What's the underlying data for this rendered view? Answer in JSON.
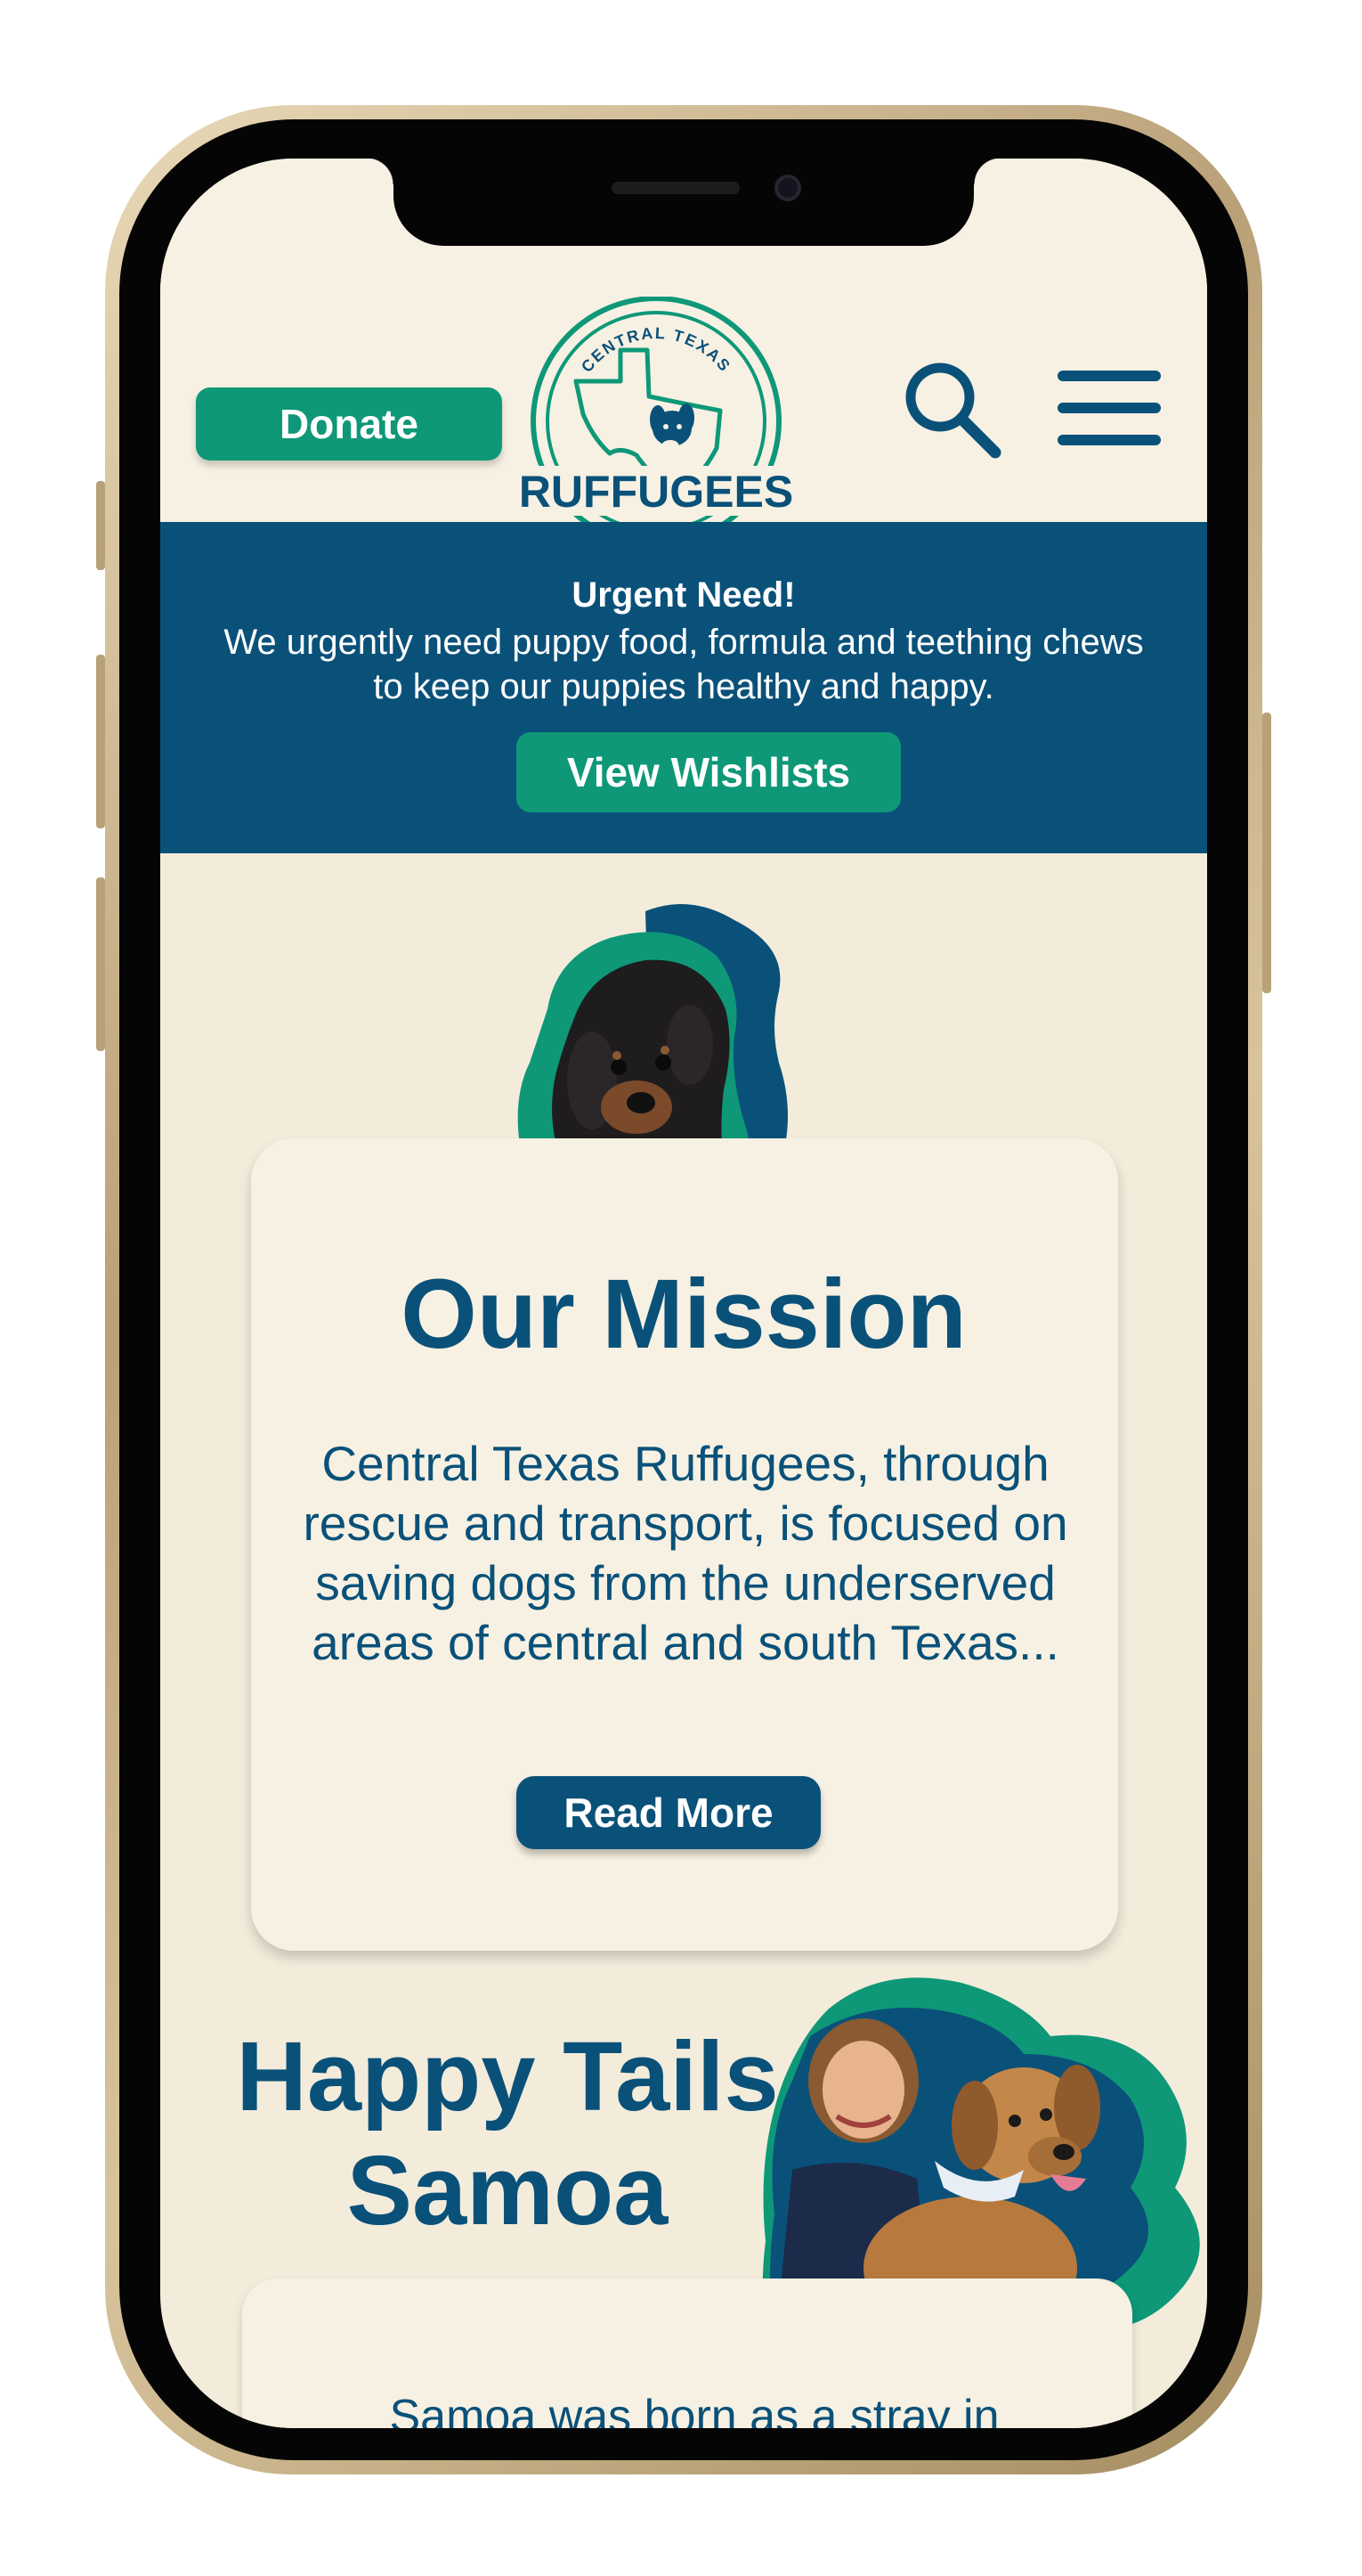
{
  "header": {
    "donate_label": "Donate",
    "logo_top_text": "CENTRAL TEXAS",
    "logo_main_text": "RUFFUGEES"
  },
  "banner": {
    "title": "Urgent Need!",
    "text": "We urgently need puppy food, formula and teething chews to keep our puppies healthy and happy.",
    "button_label": "View Wishlists"
  },
  "mission": {
    "title": "Our Mission",
    "text": "Central Texas Ruffugees, through rescue and transport, is focused on saving dogs from the underserved areas of central and south Texas...",
    "button_label": "Read More"
  },
  "happy_tails": {
    "title_line1": "Happy Tails",
    "title_line2": "Samoa",
    "text": "Samoa was born as a stray in"
  },
  "icons": {
    "search": "search-icon",
    "menu": "hamburger-menu-icon"
  },
  "colors": {
    "brand_blue": "#0a5179",
    "brand_green": "#0e9878",
    "background_cream": "#f3ecdb",
    "card_cream": "#f7f1e3"
  }
}
